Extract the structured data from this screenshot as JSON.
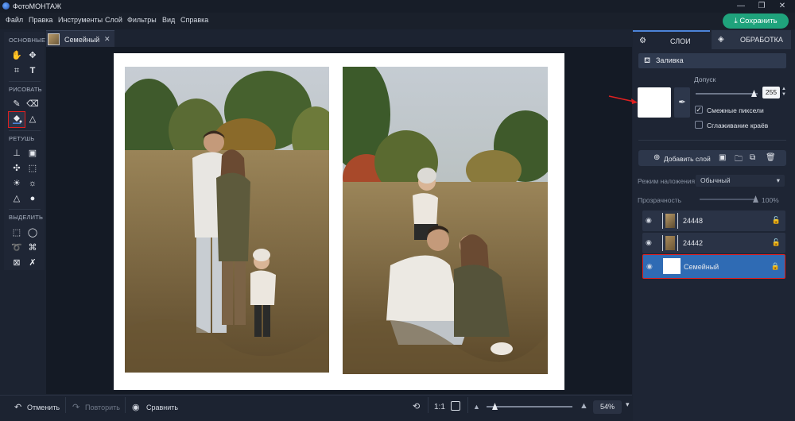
{
  "app": {
    "title": "ФотоМОНТАЖ",
    "save_label": "Сохранить"
  },
  "menu": {
    "items": [
      "Файл",
      "Правка",
      "Инструменты",
      "Слой",
      "Фильтры",
      "Вид",
      "Справка"
    ]
  },
  "toolbar": {
    "sections": [
      "ОСНОВНЫЕ",
      "РИСОВАТЬ",
      "РЕТУШЬ",
      "ВЫДЕЛИТЬ"
    ]
  },
  "document": {
    "tab_title": "Семейный",
    "close_label": "✕"
  },
  "bottom": {
    "undo_label": "Отменить",
    "redo_label": "Повторить",
    "compare_label": "Сравнить",
    "actual_size_label": "1:1",
    "zoom_label": "54%",
    "zoom_level": 0.54
  },
  "panel": {
    "tabs": [
      "СЛОИ",
      "ОБРАБОТКА"
    ],
    "fill_header": "Заливка",
    "fill_color": "#ffffff",
    "tolerance_label": "Допуск",
    "tolerance_value": "255",
    "adjacent_label": "Смежные пиксели",
    "adjacent_checked": true,
    "smooth_label": "Сглаживание краёв",
    "smooth_checked": false,
    "add_layer_label": "Добавить слой",
    "blend_mode_label": "Режим наложения:",
    "blend_mode_value": "Обычный",
    "opacity_label": "Прозрачность",
    "opacity_value": "100%",
    "layers": [
      {
        "name": "24448",
        "selected": false
      },
      {
        "name": "24442",
        "selected": false
      },
      {
        "name": "Семейный",
        "selected": true
      }
    ]
  },
  "colors": {
    "accent_save": "#1fa37c",
    "selected_layer": "#2f6bb4",
    "highlight_red": "#e02020"
  }
}
